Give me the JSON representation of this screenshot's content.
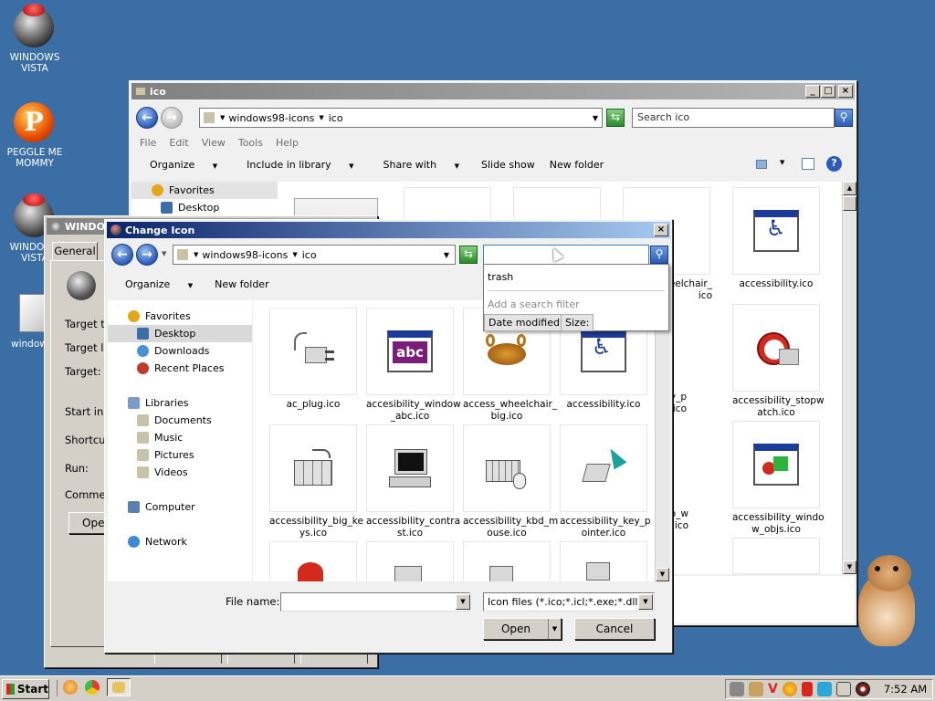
{
  "desktop": {
    "icons": [
      {
        "label": "WINDOWS VISTA",
        "icon": "vista-orb-icon"
      },
      {
        "label": "PEGGLE ME MOMMY",
        "icon": "peggle-icon"
      },
      {
        "label": "WINDOWS VISTA",
        "icon": "vista-orb-icon"
      },
      {
        "label": "windows9",
        "icon": "file-icon"
      }
    ]
  },
  "explorer": {
    "title": "ico",
    "breadcrumb": [
      "windows98-icons",
      "ico"
    ],
    "search_placeholder": "Search ico",
    "menu": [
      "File",
      "Edit",
      "View",
      "Tools",
      "Help"
    ],
    "toolbar": [
      "Organize",
      "Include in library",
      "Share with",
      "Slide show",
      "New folder"
    ],
    "nav": [
      "Favorites",
      "Desktop"
    ],
    "files": [
      {
        "name": "accessibility.ico"
      },
      {
        "name": "eelchair_\nico"
      },
      {
        "name": "accessibility_stopw\natch.ico"
      },
      {
        "name": "y_key_p\nico"
      },
      {
        "name": "accessibility_windo\nw_objs.ico"
      },
      {
        "name": "_two_w\n.ico"
      }
    ]
  },
  "properties": {
    "title": "WINDO",
    "tab": "General",
    "fields": [
      "Target ty",
      "Target lo",
      "Target:",
      "Start in:",
      "Shortcut",
      "Run:",
      "Commen"
    ],
    "button": "Ope"
  },
  "dialog": {
    "title": "Change Icon",
    "breadcrumb": [
      "windows98-icons",
      "ico"
    ],
    "toolbar": [
      "Organize",
      "New folder"
    ],
    "nav": {
      "favorites": [
        "Favorites",
        "Desktop",
        "Downloads",
        "Recent Places"
      ],
      "libraries": [
        "Libraries",
        "Documents",
        "Music",
        "Pictures",
        "Videos"
      ],
      "computer": "Computer",
      "network": "Network"
    },
    "files": [
      {
        "name": "ac_plug.ico"
      },
      {
        "name": "accesibility_window\n_abc.ico"
      },
      {
        "name": "access_wheelchair_\nbig.ico"
      },
      {
        "name": "accessibility.ico"
      },
      {
        "name": "accessibility_big_ke\nys.ico"
      },
      {
        "name": "accessibility_contra\nst.ico"
      },
      {
        "name": "accessibility_kbd_m\nouse.ico"
      },
      {
        "name": "accessibility_key_p\nointer.ico"
      }
    ],
    "search_dropdown": {
      "suggestion": "trash",
      "add_filter": "Add a search filter",
      "filters": [
        "Date modified:",
        "Size:"
      ]
    },
    "filename_label": "File name:",
    "filename_value": "",
    "filetype": "Icon files (*.ico;*.icl;*.exe;*.dll)",
    "open_label": "Open",
    "cancel_label": "Cancel"
  },
  "taskbar": {
    "start": "Start",
    "clock": "7:52 AM"
  }
}
